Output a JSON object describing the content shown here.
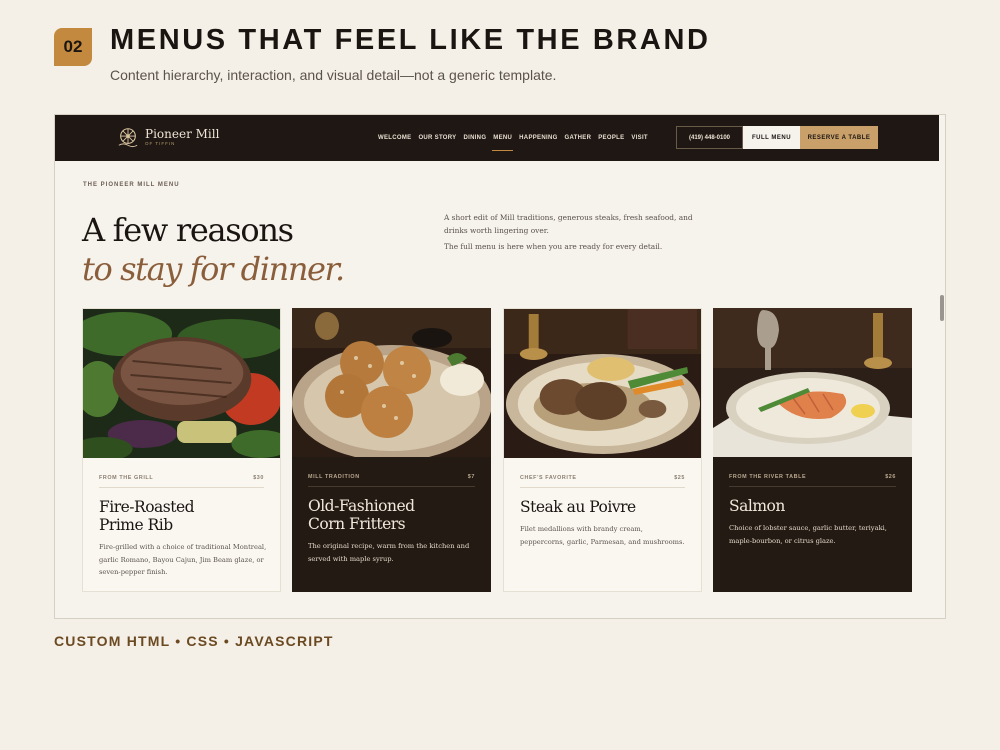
{
  "slide": {
    "number": "02",
    "title": "MENUS THAT FEEL LIKE THE BRAND",
    "subtitle": "Content hierarchy, interaction, and visual detail—not a generic template.",
    "footer": "CUSTOM HTML • CSS • JAVASCRIPT"
  },
  "site": {
    "logo": {
      "name": "Pioneer Mill",
      "tagline": "OF TIFFIN",
      "icon": "mill-wheel-icon"
    },
    "nav": [
      {
        "label": "WELCOME",
        "active": false
      },
      {
        "label": "OUR STORY",
        "active": false
      },
      {
        "label": "DINING",
        "active": false
      },
      {
        "label": "MENU",
        "active": true
      },
      {
        "label": "HAPPENING",
        "active": false
      },
      {
        "label": "GATHER",
        "active": false
      },
      {
        "label": "PEOPLE",
        "active": false
      },
      {
        "label": "VISIT",
        "active": false
      }
    ],
    "phone": "(419) 448-0100",
    "full_menu": "FULL MENU",
    "reserve": "RESERVE A TABLE"
  },
  "hero": {
    "eyebrow": "THE PIONEER MILL MENU",
    "line1": "A few reasons",
    "line2": "to stay for dinner.",
    "intro1": "A short edit of Mill traditions, generous steaks, fresh seafood, and drinks worth lingering over.",
    "intro2": "The full menu is here when you are ready for every detail."
  },
  "cards": [
    {
      "category": "FROM THE GRILL",
      "price": "$30",
      "name": "Fire-Roasted Prime Rib",
      "description": "Fire-grilled with a choice of traditional Montreal, garlic Romano, Bayou Cajun, Jim Beam glaze, or seven-pepper finish.",
      "theme": "light",
      "image": "grilled-steak-photo"
    },
    {
      "category": "MILL TRADITION",
      "price": "$7",
      "name": "Old-Fashioned Corn Fritters",
      "description": "The original recipe, warm from the kitchen and served with maple syrup.",
      "theme": "dark",
      "image": "corn-fritters-photo"
    },
    {
      "category": "CHEF'S FAVORITE",
      "price": "$25",
      "name": "Steak au Poivre",
      "description": "Filet medallions with brandy cream, peppercorns, garlic, Parmesan, and mushrooms.",
      "theme": "light",
      "image": "steak-au-poivre-photo"
    },
    {
      "category": "FROM THE RIVER TABLE",
      "price": "$26",
      "name": "Salmon",
      "description": "Choice of lobster sauce, garlic butter, teriyaki, maple-bourbon, or citrus glaze.",
      "theme": "dark",
      "image": "salmon-plate-photo"
    }
  ],
  "colors": {
    "page_bg": "#f4efe7",
    "accent": "#c38a3f",
    "nav_bg": "#1e1713",
    "hero_italic": "#8a5e3b",
    "footer": "#6b4a22"
  }
}
